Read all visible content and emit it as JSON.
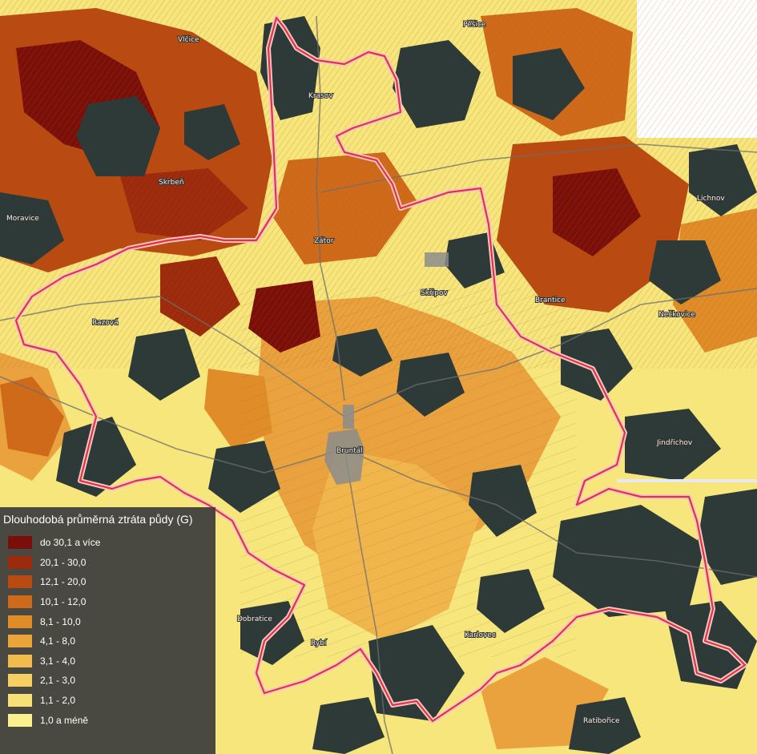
{
  "legend": {
    "title": "Dlouhodobá průměrná ztráta půdy (G)",
    "items": [
      {
        "label": "do 30,1 a více",
        "color": "#7a0f0a"
      },
      {
        "label": "20,1 - 30,0",
        "color": "#9c2a0c"
      },
      {
        "label": "12,1 - 20,0",
        "color": "#b84a12"
      },
      {
        "label": "10,1 - 12,0",
        "color": "#cf6a1a"
      },
      {
        "label": "8,1 - 10,0",
        "color": "#e08c28"
      },
      {
        "label": "4,1 - 8,0",
        "color": "#eaa43a"
      },
      {
        "label": "3,1 - 4,0",
        "color": "#f1bb4e"
      },
      {
        "label": "2,1 - 3,0",
        "color": "#f5cf62"
      },
      {
        "label": "1,1 - 2,0",
        "color": "#f8e078"
      },
      {
        "label": "1,0 a méně",
        "color": "#fbf08e"
      }
    ]
  },
  "colors": {
    "forest": "#2d3a37",
    "low_erosion": "#f6e67c",
    "boundary": "#e0343f",
    "boundary_outline": "#f7c7c7",
    "background": "#ffffff"
  },
  "places": [
    {
      "name": "Vlčice"
    },
    {
      "name": "Pěšice"
    },
    {
      "name": "Krasov"
    },
    {
      "name": "Bruntál"
    },
    {
      "name": "Moravice"
    },
    {
      "name": "Razová"
    },
    {
      "name": "Skřipov"
    },
    {
      "name": "Brantice"
    },
    {
      "name": "Nečkovice"
    },
    {
      "name": "Lichnov"
    },
    {
      "name": "Skrbeň"
    },
    {
      "name": "Zátor"
    },
    {
      "name": "Dobratice"
    },
    {
      "name": "Rybí"
    },
    {
      "name": "Ratibořice"
    },
    {
      "name": "Karlovec"
    },
    {
      "name": "Jindřichov"
    }
  ]
}
